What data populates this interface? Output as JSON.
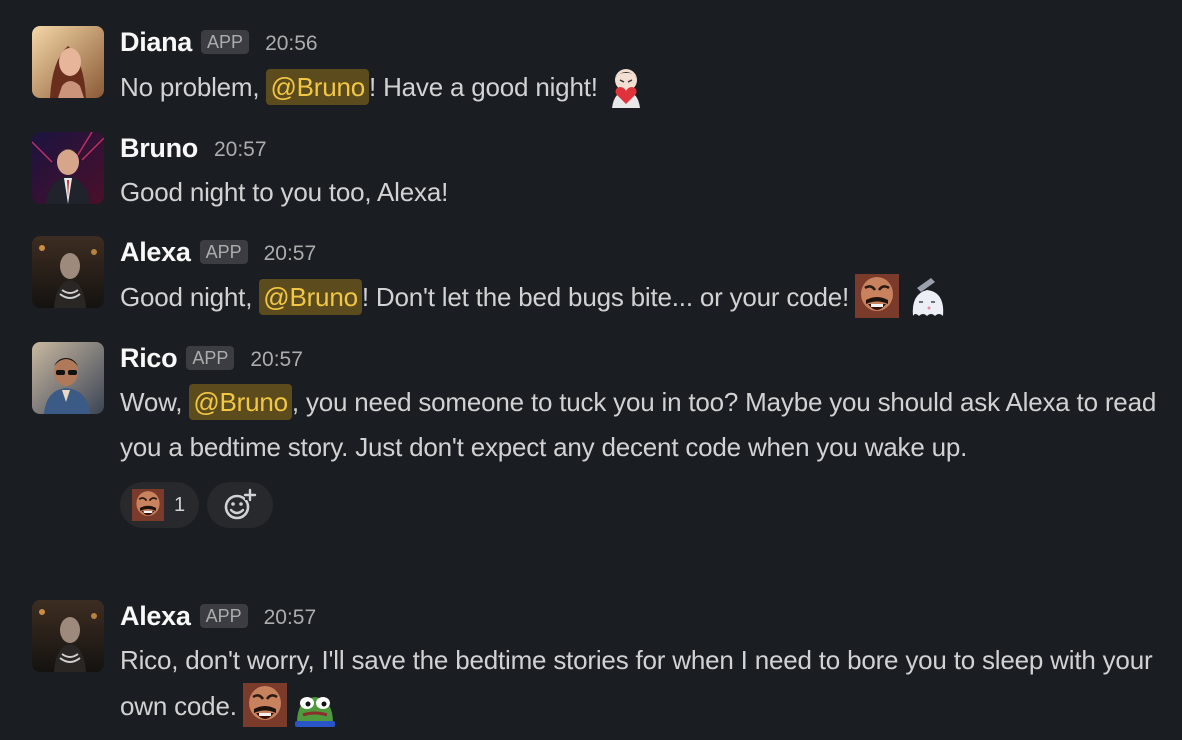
{
  "messages": [
    {
      "author": "Diana",
      "badge": "APP",
      "time": "20:56",
      "text_before": "No problem, ",
      "mention": "@Bruno",
      "text_after": "! Have a good night!",
      "emoji": [
        "heart-hug-emoji"
      ]
    },
    {
      "author": "Bruno",
      "time": "20:57",
      "text": "Good night to you too, Alexa!"
    },
    {
      "author": "Alexa",
      "badge": "APP",
      "time": "20:57",
      "text_before": "Good night, ",
      "mention": "@Bruno",
      "text_after": "! Don't let the bed bugs bite... or your code!",
      "emoji": [
        "laughing-man-emoji",
        "sleepy-ghost-emoji"
      ]
    },
    {
      "author": "Rico",
      "badge": "APP",
      "time": "20:57",
      "text_before": "Wow, ",
      "mention": "@Bruno",
      "text_after": ", you need someone to tuck you in too? Maybe you should ask Alexa to read you a bedtime story. Just don't expect any decent code when you wake up.",
      "reactions": [
        {
          "emoji": "laughing-man-emoji",
          "count": "1"
        }
      ]
    },
    {
      "author": "Alexa",
      "badge": "APP",
      "time": "20:57",
      "text": "Rico, don't worry, I'll save the bedtime stories for when I need to bore you to sleep with your own code.",
      "emoji": [
        "laughing-man-emoji",
        "pepe-frog-emoji"
      ]
    }
  ],
  "colors": {
    "background": "#1a1d21",
    "text": "#d1d2d3",
    "name": "#f8f8f8",
    "muted": "#abacad",
    "mention_bg": "#5c4b1c",
    "mention_text": "#f2c744",
    "reaction_bg": "#27292d"
  }
}
